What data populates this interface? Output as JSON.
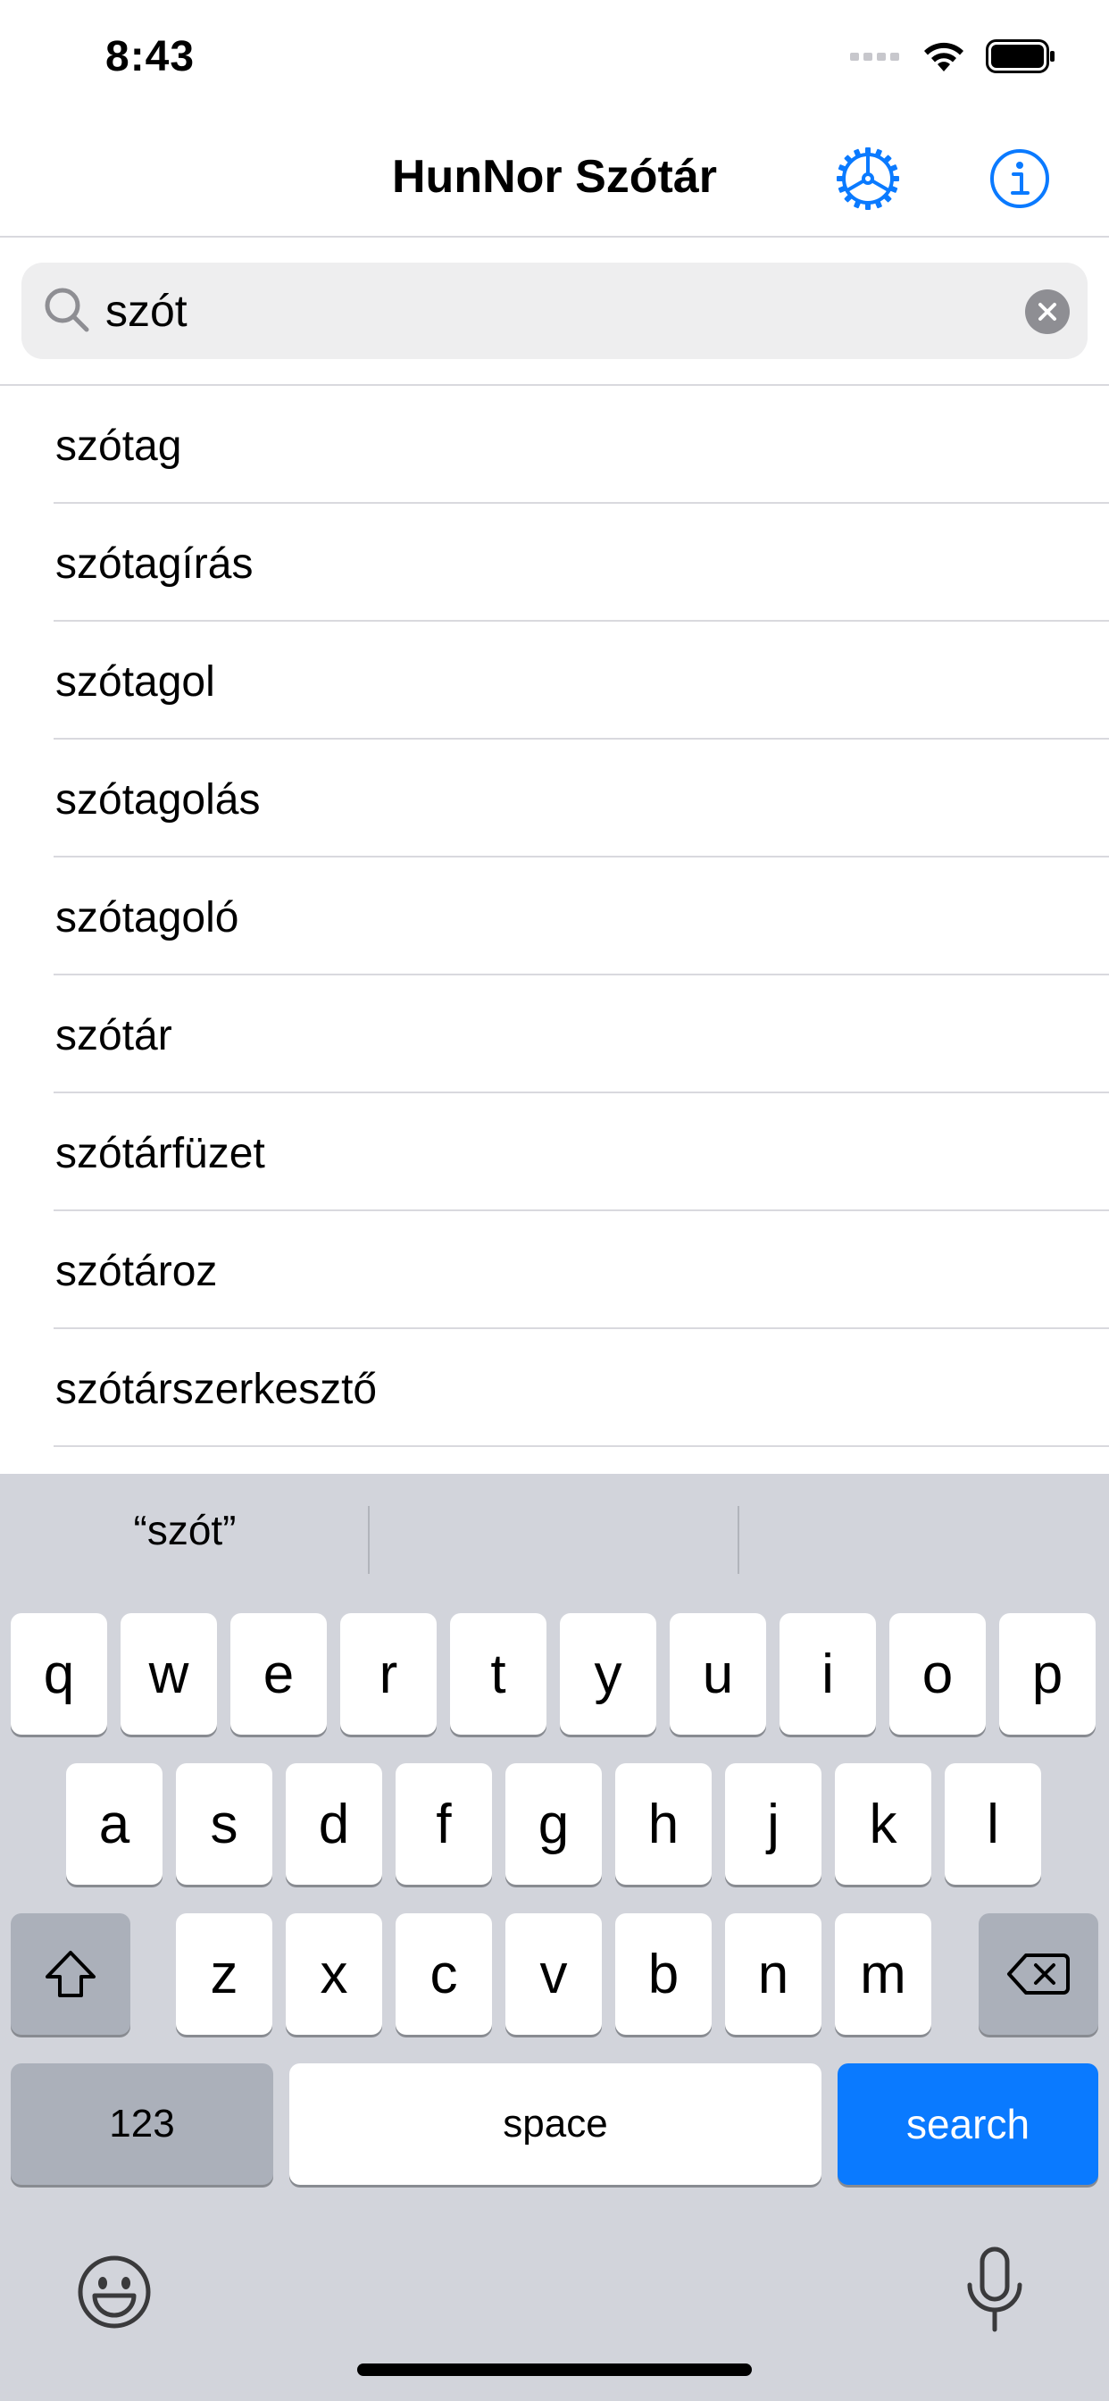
{
  "status_bar": {
    "time": "8:43"
  },
  "nav": {
    "title": "HunNor Szótár"
  },
  "search": {
    "value": "szót",
    "placeholder": ""
  },
  "results": [
    "szótag",
    "szótagírás",
    "szótagol",
    "szótagolás",
    "szótagoló",
    "szótár",
    "szótárfüzet",
    "szótároz",
    "szótárszerkesztő"
  ],
  "keyboard": {
    "suggestion_1": "“szót”",
    "suggestion_2": "",
    "suggestion_3": "",
    "row1": [
      "q",
      "w",
      "e",
      "r",
      "t",
      "y",
      "u",
      "i",
      "o",
      "p"
    ],
    "row2": [
      "a",
      "s",
      "d",
      "f",
      "g",
      "h",
      "j",
      "k",
      "l"
    ],
    "row3": [
      "z",
      "x",
      "c",
      "v",
      "b",
      "n",
      "m"
    ],
    "numbers_label": "123",
    "space_label": "space",
    "search_label": "search"
  },
  "colors": {
    "accent": "#0a7aff",
    "keyboard_bg": "#d2d4db"
  }
}
